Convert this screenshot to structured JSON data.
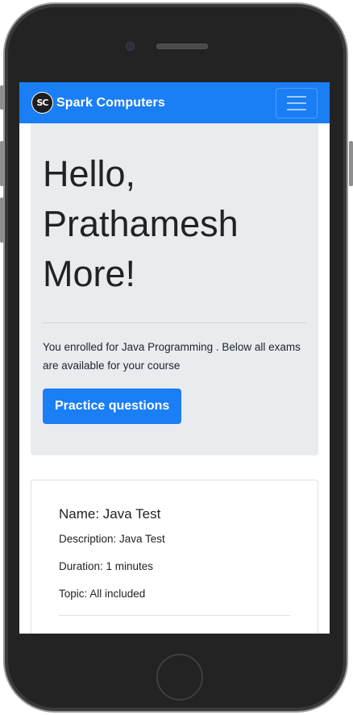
{
  "navbar": {
    "logo_text": "SC",
    "brand": "Spark Computers",
    "menu_icon": "hamburger-icon"
  },
  "jumbotron": {
    "greeting_line1": "Hello,",
    "greeting_line2": "Prathamesh",
    "greeting_line3": "More!",
    "message": "You enrolled for Java Programming . Below all exams are available for your course",
    "practice_button": "Practice questions"
  },
  "exam_card": {
    "name": "Name: Java Test",
    "description": "Description: Java Test",
    "duration": "Duration: 1 minutes",
    "topic": "Topic: All included"
  },
  "colors": {
    "primary": "#1a7ef5",
    "jumbotron_bg": "#e9ecef",
    "device_frame": "#232323"
  }
}
